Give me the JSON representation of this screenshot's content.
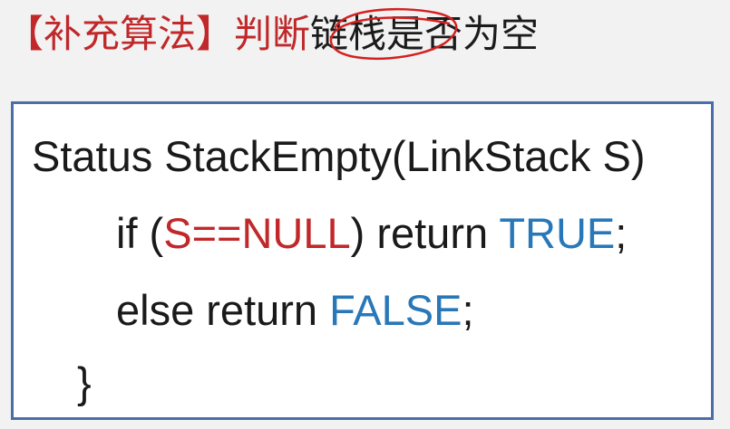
{
  "title": {
    "bracket_label": "【补充算法】",
    "verb": "判断",
    "rest": "链栈是否为空"
  },
  "code": {
    "line1": "Status StackEmpty(LinkStack S)",
    "line2": {
      "if_kw": "if (",
      "condition": "S==NULL",
      "close_return": ") return ",
      "true_val": "TRUE",
      "semicolon": ";"
    },
    "line3": {
      "else_return": "else return ",
      "false_val": "FALSE",
      "semicolon": ";"
    },
    "line4": "}"
  },
  "colors": {
    "title_red": "#c0282a",
    "keyword_blue": "#2878b9",
    "border_blue": "#4a6fa8",
    "annotation_red": "#d42020"
  }
}
